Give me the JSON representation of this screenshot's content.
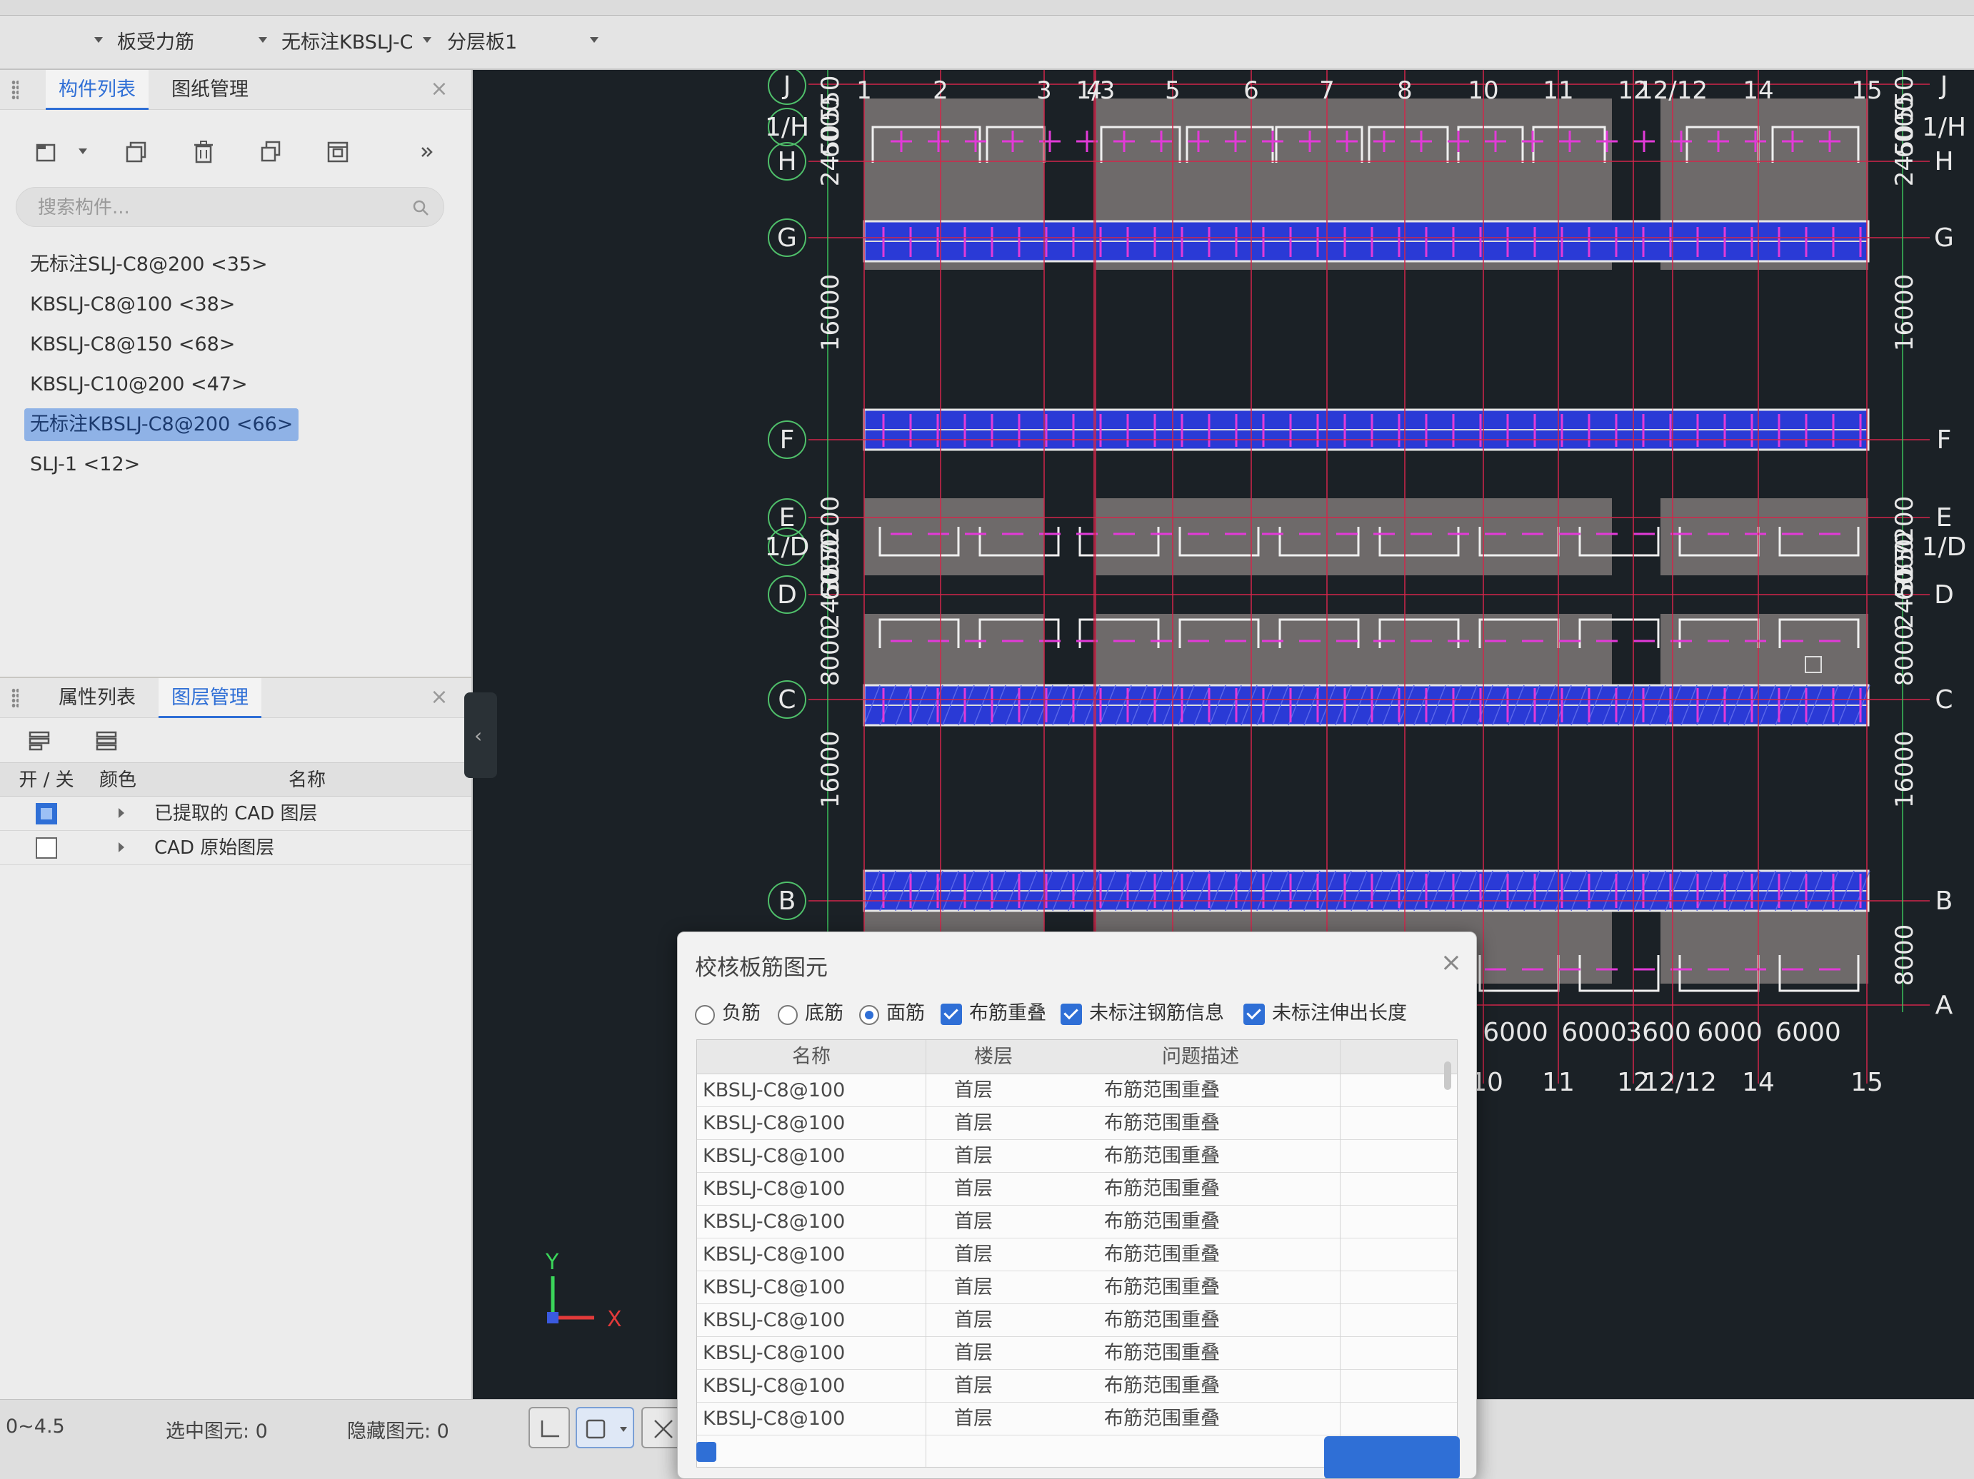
{
  "toolbar": {
    "dropdown_1": "板受力筋",
    "dropdown_2": "无标注KBSLJ-C",
    "dropdown_3": "分层板1"
  },
  "component_panel": {
    "tab_list": "构件列表",
    "tab_drawings": "图纸管理",
    "search_placeholder": "搜索构件...",
    "items": [
      {
        "label": "无标注SLJ-C8@200 <35>"
      },
      {
        "label": "KBSLJ-C8@100 <38>"
      },
      {
        "label": "KBSLJ-C8@150 <68>"
      },
      {
        "label": "KBSLJ-C10@200 <47>"
      },
      {
        "label": "无标注KBSLJ-C8@200 <66>",
        "selected": true
      },
      {
        "label": "SLJ-1 <12>"
      }
    ]
  },
  "layer_panel": {
    "tab_props": "属性列表",
    "tab_layers": "图层管理",
    "col_toggle": "开 / 关",
    "col_color": "颜色",
    "col_name": "名称",
    "rows": [
      {
        "name": "已提取的 CAD 图层",
        "on": true
      },
      {
        "name": "CAD 原始图层",
        "on": false
      }
    ]
  },
  "canvas": {
    "background": "#1b2126",
    "row_axes": [
      "J",
      "1/H",
      "H",
      "G",
      "F",
      "E",
      "1/D",
      "D",
      "C",
      "B",
      "A"
    ],
    "col_axes_top": [
      "1",
      "2",
      "3",
      "1/3",
      "4",
      "5",
      "6",
      "7",
      "8",
      "10",
      "11",
      "12",
      "12/12",
      "14",
      "15"
    ],
    "col_axes_bottom": [
      "10",
      "11",
      "12",
      "12/12",
      "14",
      "15"
    ],
    "left_dims": [
      "6000",
      "2450",
      "550",
      "16000",
      "7200",
      "3550",
      "2450",
      "6000",
      "8000",
      "16000"
    ],
    "right_dims": [
      "6000",
      "2450",
      "550",
      "16000",
      "7200",
      "3550",
      "2450",
      "6000",
      "8000",
      "16000",
      "8000"
    ],
    "bottom_dims": [
      "6000",
      "6000",
      "3600",
      "6000",
      "6000"
    ],
    "axis_x": "X",
    "axis_y": "Y"
  },
  "status": {
    "range": "0~4.5",
    "selected_label": "选中图元: 0",
    "hidden_label": "隐藏图元: 0"
  },
  "dialog": {
    "title": "校核板筋图元",
    "options": {
      "neg": "负筋",
      "bottom": "底筋",
      "face": "面筋",
      "overlap": "布筋重叠",
      "no_info": "未标注钢筋信息",
      "no_ext": "未标注伸出长度"
    },
    "columns": {
      "name": "名称",
      "floor": "楼层",
      "desc": "问题描述"
    },
    "rows": [
      {
        "name": "KBSLJ-C8@100",
        "floor": "首层",
        "desc": "布筋范围重叠"
      },
      {
        "name": "KBSLJ-C8@100",
        "floor": "首层",
        "desc": "布筋范围重叠"
      },
      {
        "name": "KBSLJ-C8@100",
        "floor": "首层",
        "desc": "布筋范围重叠"
      },
      {
        "name": "KBSLJ-C8@100",
        "floor": "首层",
        "desc": "布筋范围重叠"
      },
      {
        "name": "KBSLJ-C8@100",
        "floor": "首层",
        "desc": "布筋范围重叠"
      },
      {
        "name": "KBSLJ-C8@100",
        "floor": "首层",
        "desc": "布筋范围重叠"
      },
      {
        "name": "KBSLJ-C8@100",
        "floor": "首层",
        "desc": "布筋范围重叠"
      },
      {
        "name": "KBSLJ-C8@100",
        "floor": "首层",
        "desc": "布筋范围重叠"
      },
      {
        "name": "KBSLJ-C8@100",
        "floor": "首层",
        "desc": "布筋范围重叠"
      },
      {
        "name": "KBSLJ-C8@100",
        "floor": "首层",
        "desc": "布筋范围重叠"
      },
      {
        "name": "KBSLJ-C8@100",
        "floor": "首层",
        "desc": "布筋范围重叠"
      }
    ]
  },
  "colors": {
    "accent": "#2f6fd6",
    "slab_fill": "#6e6a6a",
    "rebar_band": "#2a3ad6",
    "rebar_line": "#e23ad8",
    "axis_line": "#d2264a"
  }
}
